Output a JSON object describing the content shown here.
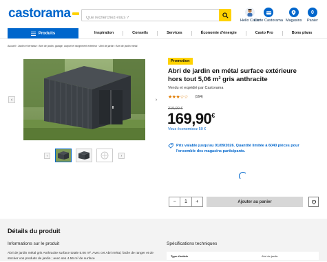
{
  "header": {
    "logo": "castorama",
    "search_placeholder": "Que recherchez-vous ?",
    "account_label": "Hello Casto",
    "card_label": "Carte Castorama",
    "stores_label": "Magasins",
    "cart_label": "Panier",
    "cart_count": "0"
  },
  "nav": {
    "products_label": "Produits",
    "links": [
      "Inspiration",
      "Conseils",
      "Services",
      "Économie d'énergie",
      "Casto Pro",
      "Bons plans"
    ]
  },
  "breadcrumb": "Accueil  ›  Jardin et terrasse  ›  Abri de jardin, garage, carport et rangement extérieur  ›  Abri de jardin  ›  Abri de jardin métal",
  "product": {
    "badge": "Promotion",
    "title": "Abri de jardin en métal surface extérieure hors tout 5,06 m² gris anthracite",
    "seller": "Vendu et expédié par Castorama",
    "rating": 3.5,
    "stars_text": "★★★☆☆",
    "reviews": "(164)",
    "old_price": "219,90 €",
    "price_main": "169,90",
    "price_currency": "€",
    "saving": "Vous économisez 50 €",
    "promo_text": "Prix valable jusqu'au 01/09/2026. Quantité limitée à 6040 pièces pour l'ensemble des magasins participants.",
    "qty_minus": "−",
    "qty_value": "1",
    "qty_plus": "+",
    "add_to_cart": "Ajouter au panier"
  },
  "details": {
    "title": "Détails du produit",
    "info_title": "Informations sur le produit",
    "info_text": "Abri de jardin métal gris Anthracite surface totale 5.06 m². Avec cet Abri métal, facile de ranger et de stocker vos produits de jardin ; avec ses 4.56 m² de surface",
    "specs_title": "Spécifications techniques",
    "spec_key": "Type d'article",
    "spec_value": "Abri de jardin"
  },
  "colors": {
    "brand_blue": "#0066cc",
    "yellow": "#ffd200",
    "navy": "#0b2a4a"
  }
}
